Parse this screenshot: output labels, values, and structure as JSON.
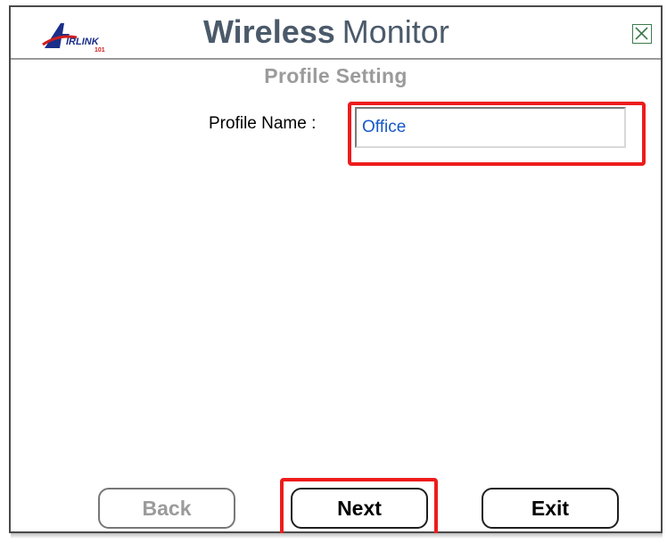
{
  "window": {
    "brand_logo_text": "AirLink 101",
    "title_bold": "Wireless",
    "title_light": "Monitor",
    "close_icon": "close-x-icon"
  },
  "profile_setting": {
    "section_title": "Profile Setting",
    "profile_name_label": "Profile Name :",
    "profile_name_value": "Office"
  },
  "buttons": {
    "back_label": "Back",
    "back_enabled": false,
    "next_label": "Next",
    "exit_label": "Exit"
  },
  "highlights": {
    "color": "#ee1c1c",
    "targets": [
      "profile-name-input",
      "next-button"
    ]
  },
  "colors": {
    "title_text": "#4b5a6a",
    "disabled_text": "#9b9b9b",
    "input_text": "#1658c8",
    "close_icon": "#3c7b4c"
  }
}
